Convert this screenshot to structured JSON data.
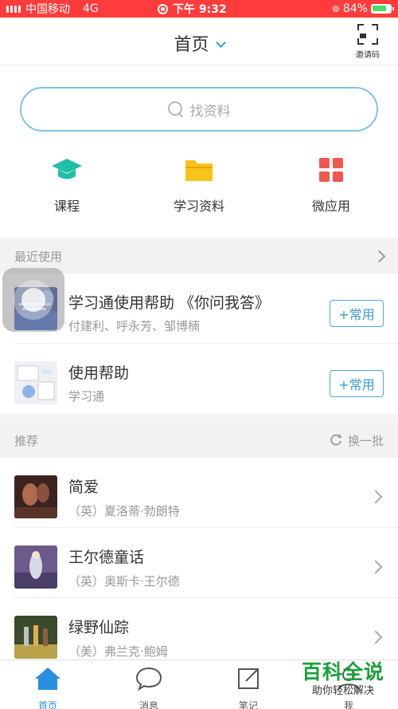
{
  "status_bar": {
    "carrier": "中国移动",
    "network": "4G",
    "time": "下午 9:32",
    "battery": "84%",
    "battery_level": 0.84,
    "background_color": "#ff3b3b"
  },
  "header": {
    "title": "首页",
    "invite_label": "邀请码"
  },
  "search": {
    "placeholder": "找资料"
  },
  "quick_links": [
    {
      "label": "课程",
      "icon": "graduation-cap-icon",
      "color": "#1fbfa8"
    },
    {
      "label": "学习资料",
      "icon": "folder-icon",
      "color": "#f7c31a"
    },
    {
      "label": "微应用",
      "icon": "grid-apps-icon",
      "color": "#f0574f"
    }
  ],
  "recent": {
    "heading": "最近使用",
    "items": [
      {
        "title": "学习通使用帮助 《你问我答》",
        "subtitle": "付建利、呼永芳、邹博楠",
        "action": "+常用"
      },
      {
        "title": "使用帮助",
        "subtitle": "学习通",
        "action": "+常用"
      }
    ]
  },
  "recommend": {
    "heading": "推荐",
    "refresh_label": "换一批",
    "items": [
      {
        "title": "简爱",
        "subtitle": "（英）夏洛蒂·勃朗特"
      },
      {
        "title": "王尔德童话",
        "subtitle": "（英）奥斯卡·王尔德"
      },
      {
        "title": "绿野仙踪",
        "subtitle": "（美）弗兰克·鲍姆"
      }
    ]
  },
  "tabbar": {
    "tabs": [
      {
        "label": "首页",
        "icon": "home-icon",
        "active": true
      },
      {
        "label": "消息",
        "icon": "chat-bubble-icon",
        "active": false
      },
      {
        "label": "笔记",
        "icon": "edit-note-icon",
        "active": false
      },
      {
        "label": "我",
        "icon": "profile-icon",
        "active": false
      }
    ],
    "accent_color": "#2a8fe0"
  },
  "watermark": {
    "main": "百科全说",
    "sub": "助你轻松解决"
  }
}
